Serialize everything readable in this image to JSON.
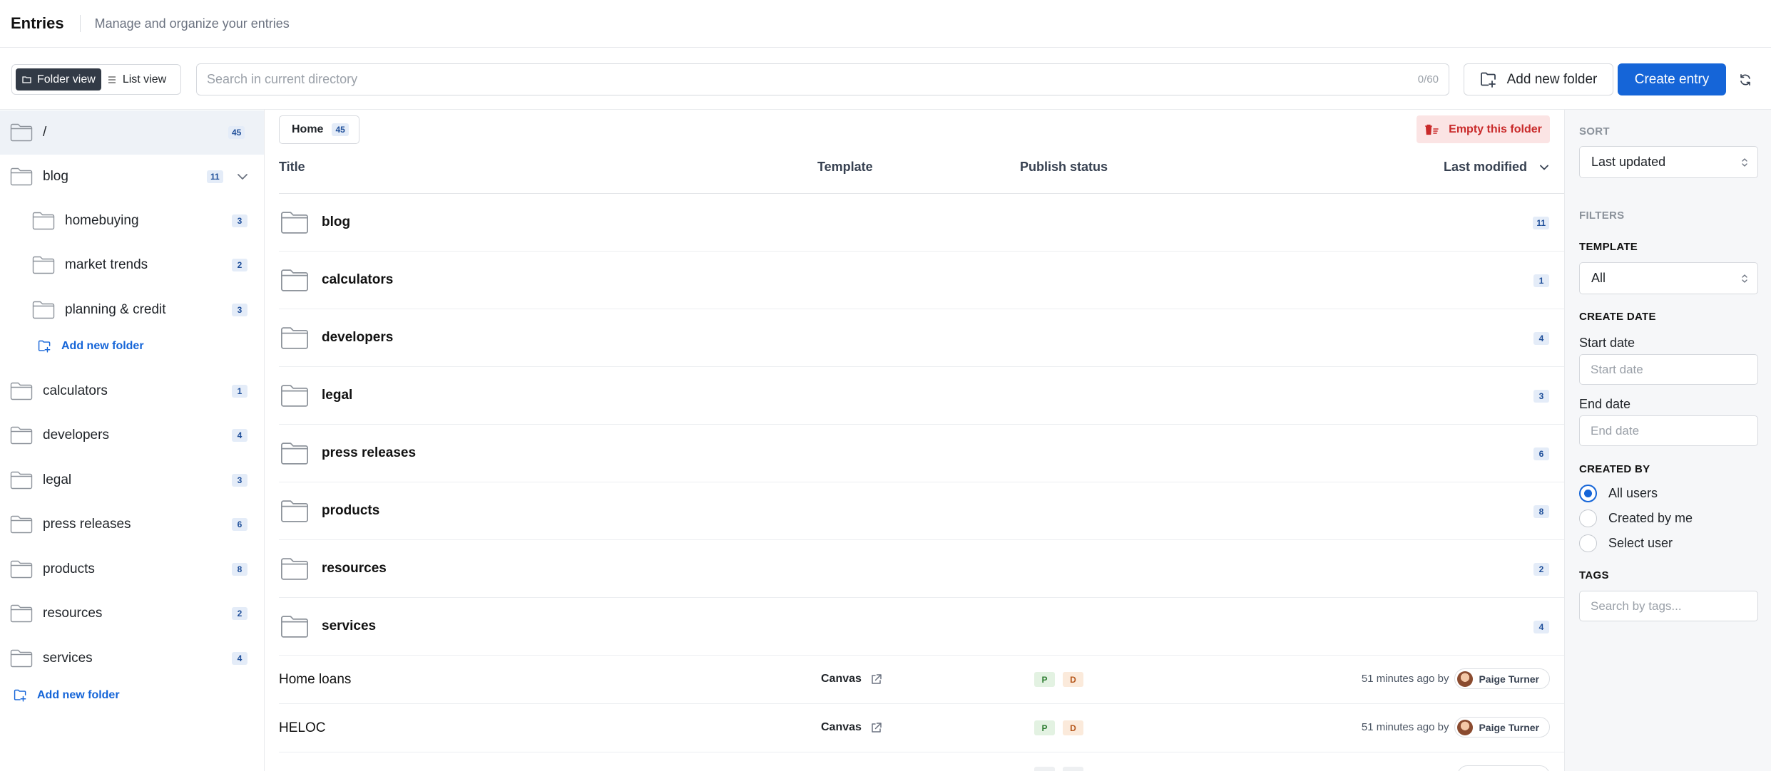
{
  "header": {
    "title": "Entries",
    "subtitle": "Manage and organize your entries"
  },
  "toolbar": {
    "folder_view_label": "Folder view",
    "list_view_label": "List view",
    "search_placeholder": "Search in current directory",
    "search_value": "",
    "search_counter": "0/60",
    "add_folder_label": "Add new folder",
    "create_entry_label": "Create entry"
  },
  "sidebar": {
    "root": {
      "label": "/",
      "count": "45"
    },
    "blog": {
      "label": "blog",
      "count": "11",
      "children": [
        {
          "label": "homebuying",
          "count": "3"
        },
        {
          "label": "market trends",
          "count": "2"
        },
        {
          "label": "planning & credit",
          "count": "3"
        }
      ],
      "add_folder_label": "Add new folder"
    },
    "folders": [
      {
        "label": "calculators",
        "count": "1"
      },
      {
        "label": "developers",
        "count": "4"
      },
      {
        "label": "legal",
        "count": "3"
      },
      {
        "label": "press releases",
        "count": "6"
      },
      {
        "label": "products",
        "count": "8"
      },
      {
        "label": "resources",
        "count": "2"
      },
      {
        "label": "services",
        "count": "4"
      }
    ],
    "add_folder_label": "Add new folder"
  },
  "main": {
    "breadcrumb": {
      "label": "Home",
      "count": "45"
    },
    "empty_folder_label": "Empty this folder",
    "columns": {
      "title": "Title",
      "template": "Template",
      "publish_status": "Publish status",
      "last_modified": "Last modified"
    },
    "folders": [
      {
        "name": "blog",
        "count": "11"
      },
      {
        "name": "calculators",
        "count": "1"
      },
      {
        "name": "developers",
        "count": "4"
      },
      {
        "name": "legal",
        "count": "3"
      },
      {
        "name": "press releases",
        "count": "6"
      },
      {
        "name": "products",
        "count": "8"
      },
      {
        "name": "resources",
        "count": "2"
      },
      {
        "name": "services",
        "count": "4"
      }
    ],
    "entries": [
      {
        "title": "Home loans",
        "template": "Canvas",
        "status_p": "P",
        "status_d": "D",
        "modified": "51 minutes ago by",
        "user": "Paige Turner"
      },
      {
        "title": "HELOC",
        "template": "Canvas",
        "status_p": "P",
        "status_d": "D",
        "modified": "51 minutes ago by",
        "user": "Paige Turner"
      }
    ]
  },
  "panel": {
    "sort_heading": "SORT",
    "sort_value": "Last updated",
    "filters_heading": "FILTERS",
    "template_heading": "TEMPLATE",
    "template_value": "All",
    "create_date_heading": "CREATE DATE",
    "start_date_label": "Start date",
    "start_date_placeholder": "Start date",
    "end_date_label": "End date",
    "end_date_placeholder": "End date",
    "created_by_heading": "CREATED BY",
    "created_by_options": [
      "All users",
      "Created by me",
      "Select user"
    ],
    "created_by_selected": "All users",
    "tags_heading": "TAGS",
    "tags_placeholder": "Search by tags..."
  },
  "colors": {
    "primary": "#1565d8",
    "danger": "#c92a2a",
    "count_bg": "#e4ecf8"
  }
}
